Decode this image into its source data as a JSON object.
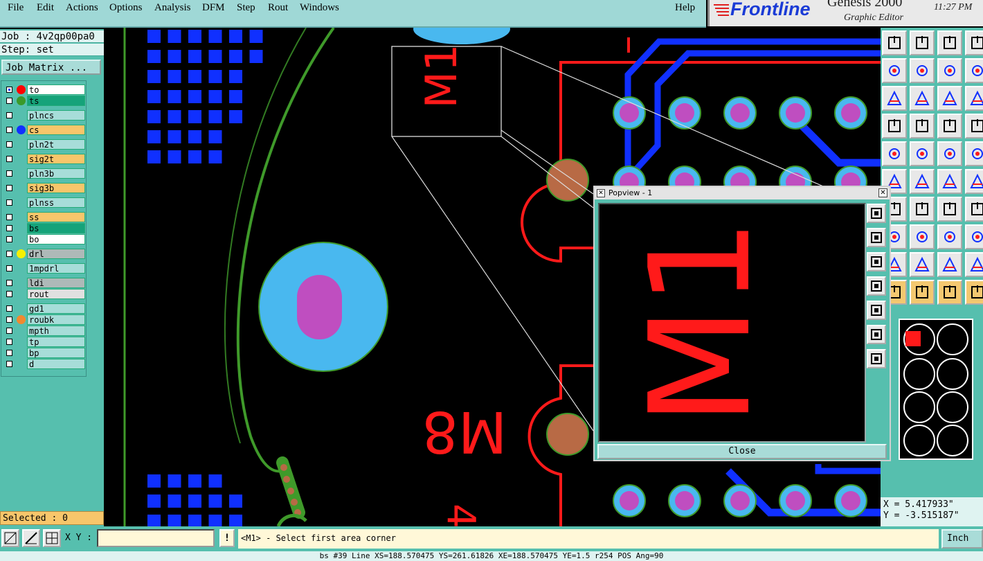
{
  "menubar": {
    "items": [
      "File",
      "Edit",
      "Actions",
      "Options",
      "Analysis",
      "DFM",
      "Step",
      "Rout",
      "Windows"
    ],
    "help": "Help"
  },
  "brand": {
    "logo_text": "Frontline",
    "product": "Genesis 2000",
    "subtitle": "Graphic Editor",
    "time": "11:27 PM"
  },
  "job": {
    "job_line": "Job : 4v2qp00pa0",
    "step_line": "Step: set",
    "matrix_button": "Job Matrix ..."
  },
  "layers": [
    {
      "name": "to",
      "color": "#ffffff",
      "dot": "#ff0000",
      "checked": true
    },
    {
      "name": "ts",
      "color": "#16a37a",
      "dot": "#3a9a2a",
      "checked": false
    },
    {
      "name": "plncs",
      "color": "#a7ddd9",
      "dot": "",
      "checked": false
    },
    {
      "name": "cs",
      "color": "#f7c66b",
      "dot": "#1030ff",
      "checked": false
    },
    {
      "name": "pln2t",
      "color": "#a7ddd9",
      "dot": "",
      "checked": false
    },
    {
      "name": "sig2t",
      "color": "#f7c66b",
      "dot": "",
      "checked": false
    },
    {
      "name": "pln3b",
      "color": "#a7ddd9",
      "dot": "",
      "checked": false
    },
    {
      "name": "sig3b",
      "color": "#f7c66b",
      "dot": "",
      "checked": false
    },
    {
      "name": "plnss",
      "color": "#a7ddd9",
      "dot": "",
      "checked": false
    },
    {
      "name": "ss",
      "color": "#f7c66b",
      "dot": "",
      "checked": false
    },
    {
      "name": "bs",
      "color": "#16a37a",
      "dot": "",
      "checked": false
    },
    {
      "name": "bo",
      "color": "#ffffff",
      "dot": "",
      "checked": false
    },
    {
      "name": "drl",
      "color": "#aeb9b8",
      "dot": "#f5f000",
      "checked": false
    },
    {
      "name": "1mpdrl",
      "color": "#a7ddd9",
      "dot": "",
      "checked": false
    },
    {
      "name": "ldi",
      "color": "#aeb9b8",
      "dot": "",
      "checked": false
    },
    {
      "name": "rout",
      "color": "#e0e0e0",
      "dot": "",
      "checked": false
    },
    {
      "name": "gd1",
      "color": "#a7ddd9",
      "dot": "",
      "checked": false
    },
    {
      "name": "roubk",
      "color": "#a7ddd9",
      "dot": "#f08a30",
      "checked": false
    },
    {
      "name": "mpth",
      "color": "#a7ddd9",
      "dot": "",
      "checked": false
    },
    {
      "name": "tp",
      "color": "#a7ddd9",
      "dot": "",
      "checked": false
    },
    {
      "name": "bp",
      "color": "#a7ddd9",
      "dot": "",
      "checked": false
    },
    {
      "name": "d",
      "color": "#a7ddd9",
      "dot": "",
      "checked": false
    }
  ],
  "selected_label": "Selected : 0",
  "canvas_labels": {
    "m1": "M1",
    "m8": "M8",
    "four": "4"
  },
  "popview": {
    "title": "Popview - 1",
    "close_label": "Close",
    "zoom_text": "M1"
  },
  "coords": {
    "x": "X = 5.417933\"",
    "y": "Y = -3.515187\""
  },
  "bottom": {
    "xy_label": "X Y :",
    "xy_value": "",
    "excl": "!",
    "prompt": "<M1> - Select first area corner",
    "unit": "Inch"
  },
  "status_line": "bs #39 Line XS=188.570475 YS=261.61826 XE=188.570475 YE=1.5 r254 POS Ang=90",
  "colors": {
    "accent": "#56bfae",
    "trace_red": "#ff1a1a",
    "trace_blue": "#1030ff",
    "pad_cyan": "#49b8ef",
    "pad_magenta": "#bf4ec0",
    "pad_copper": "#b86a45",
    "outline_green": "#3f9a2a"
  }
}
